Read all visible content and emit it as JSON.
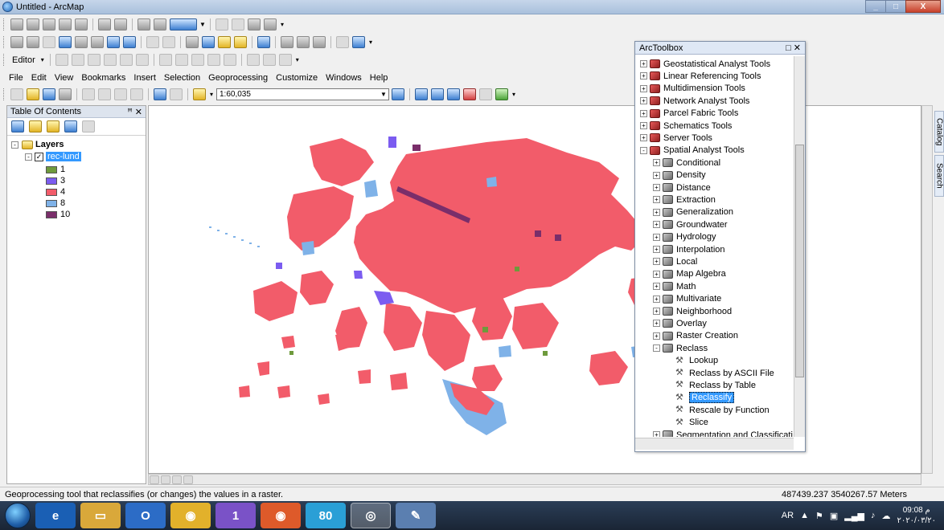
{
  "window": {
    "title": "Untitled - ArcMap",
    "btn_min": "_",
    "btn_max": "□",
    "btn_close": "X"
  },
  "toolbars": {
    "editor_label": "Editor",
    "scale": "1:60,035"
  },
  "menu": [
    "File",
    "Edit",
    "View",
    "Bookmarks",
    "Insert",
    "Selection",
    "Geoprocessing",
    "Customize",
    "Windows",
    "Help"
  ],
  "toc": {
    "title": "Table Of Contents",
    "pin": "ꟸ ✕",
    "layers_label": "Layers",
    "layer_name": "rec-lund",
    "classes": [
      {
        "label": "1",
        "color": "#6e9a3c"
      },
      {
        "label": "3",
        "color": "#7b5cf0"
      },
      {
        "label": "4",
        "color": "#f25c6a"
      },
      {
        "label": "8",
        "color": "#7fb2e8"
      },
      {
        "label": "10",
        "color": "#7a2e6a"
      }
    ]
  },
  "toolbox": {
    "title": "ArcToolbox",
    "title_btns": "□ ✕",
    "items": [
      {
        "label": "Geostatistical Analyst Tools",
        "level": 0,
        "kind": "box",
        "exp": "+"
      },
      {
        "label": "Linear Referencing Tools",
        "level": 0,
        "kind": "box",
        "exp": "+"
      },
      {
        "label": "Multidimension Tools",
        "level": 0,
        "kind": "box",
        "exp": "+"
      },
      {
        "label": "Network Analyst Tools",
        "level": 0,
        "kind": "box",
        "exp": "+"
      },
      {
        "label": "Parcel Fabric Tools",
        "level": 0,
        "kind": "box",
        "exp": "+"
      },
      {
        "label": "Schematics Tools",
        "level": 0,
        "kind": "box",
        "exp": "+"
      },
      {
        "label": "Server Tools",
        "level": 0,
        "kind": "box",
        "exp": "+"
      },
      {
        "label": "Spatial Analyst Tools",
        "level": 0,
        "kind": "box",
        "exp": "-"
      },
      {
        "label": "Conditional",
        "level": 1,
        "kind": "sub",
        "exp": "+"
      },
      {
        "label": "Density",
        "level": 1,
        "kind": "sub",
        "exp": "+"
      },
      {
        "label": "Distance",
        "level": 1,
        "kind": "sub",
        "exp": "+"
      },
      {
        "label": "Extraction",
        "level": 1,
        "kind": "sub",
        "exp": "+"
      },
      {
        "label": "Generalization",
        "level": 1,
        "kind": "sub",
        "exp": "+"
      },
      {
        "label": "Groundwater",
        "level": 1,
        "kind": "sub",
        "exp": "+"
      },
      {
        "label": "Hydrology",
        "level": 1,
        "kind": "sub",
        "exp": "+"
      },
      {
        "label": "Interpolation",
        "level": 1,
        "kind": "sub",
        "exp": "+"
      },
      {
        "label": "Local",
        "level": 1,
        "kind": "sub",
        "exp": "+"
      },
      {
        "label": "Map Algebra",
        "level": 1,
        "kind": "sub",
        "exp": "+"
      },
      {
        "label": "Math",
        "level": 1,
        "kind": "sub",
        "exp": "+"
      },
      {
        "label": "Multivariate",
        "level": 1,
        "kind": "sub",
        "exp": "+"
      },
      {
        "label": "Neighborhood",
        "level": 1,
        "kind": "sub",
        "exp": "+"
      },
      {
        "label": "Overlay",
        "level": 1,
        "kind": "sub",
        "exp": "+"
      },
      {
        "label": "Raster Creation",
        "level": 1,
        "kind": "sub",
        "exp": "+"
      },
      {
        "label": "Reclass",
        "level": 1,
        "kind": "sub",
        "exp": "-"
      },
      {
        "label": "Lookup",
        "level": 2,
        "kind": "tool",
        "exp": ""
      },
      {
        "label": "Reclass by ASCII File",
        "level": 2,
        "kind": "tool",
        "exp": ""
      },
      {
        "label": "Reclass by Table",
        "level": 2,
        "kind": "tool",
        "exp": ""
      },
      {
        "label": "Reclassify",
        "level": 2,
        "kind": "tool",
        "exp": "",
        "selected": true
      },
      {
        "label": "Rescale by Function",
        "level": 2,
        "kind": "tool",
        "exp": ""
      },
      {
        "label": "Slice",
        "level": 2,
        "kind": "tool",
        "exp": ""
      },
      {
        "label": "Segmentation and Classificatio",
        "level": 1,
        "kind": "sub",
        "exp": "+"
      }
    ]
  },
  "side_tabs": {
    "catalog": "Catalog",
    "search": "Search"
  },
  "status": {
    "message": "Geoprocessing tool that reclassifies (or changes) the values in a raster.",
    "coords": "487439.237  3540267.57 Meters"
  },
  "taskbar": {
    "lang": "AR",
    "time": "09:08 م",
    "date": "٢٠٢٠/٠٣/٢٠",
    "badge_viber": "1",
    "badge_telegram": "80"
  }
}
